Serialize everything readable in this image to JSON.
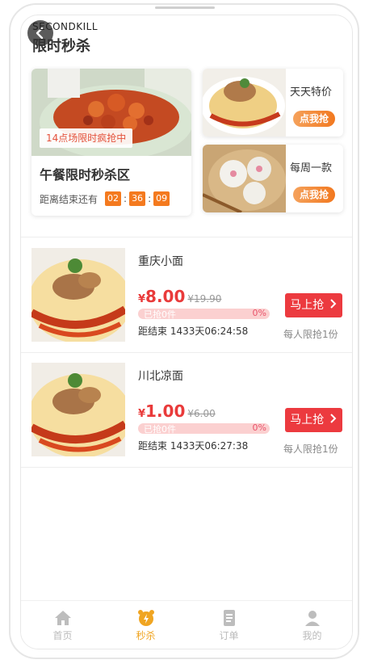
{
  "header": {
    "subtitle_en": "SECONDKILL",
    "title": "限时秒杀"
  },
  "featured": {
    "tag": "14点场限时疯抢中",
    "title": "午餐限时秒杀区",
    "countdown_label": "距离结束还有",
    "hours": "02",
    "minutes": "36",
    "seconds": "09"
  },
  "side_cards": [
    {
      "title": "天天特价",
      "button": "点我抢"
    },
    {
      "title": "每周一款",
      "button": "点我抢"
    }
  ],
  "items": [
    {
      "name": "重庆小面",
      "currency": "¥",
      "price": "8.00",
      "original_price": "¥19.90",
      "sold": "已抢0件",
      "percent": "0%",
      "countdown": "距结束 1433天06:24:58",
      "button": "马上抢",
      "limit": "每人限抢1份"
    },
    {
      "name": "川北凉面",
      "currency": "¥",
      "price": "1.00",
      "original_price": "¥6.00",
      "sold": "已抢0件",
      "percent": "0%",
      "countdown": "距结束 1433天06:27:38",
      "button": "马上抢",
      "limit": "每人限抢1份"
    }
  ],
  "tabbar": [
    {
      "label": "首页",
      "icon": "home-icon",
      "active": false
    },
    {
      "label": "秒杀",
      "icon": "alarm-clock-icon",
      "active": true
    },
    {
      "label": "订单",
      "icon": "order-list-icon",
      "active": false
    },
    {
      "label": "我的",
      "icon": "user-icon",
      "active": false
    }
  ],
  "colors": {
    "accent_red": "#ec3a3f",
    "accent_orange": "#f47a1f",
    "tab_active": "#f0a522"
  }
}
